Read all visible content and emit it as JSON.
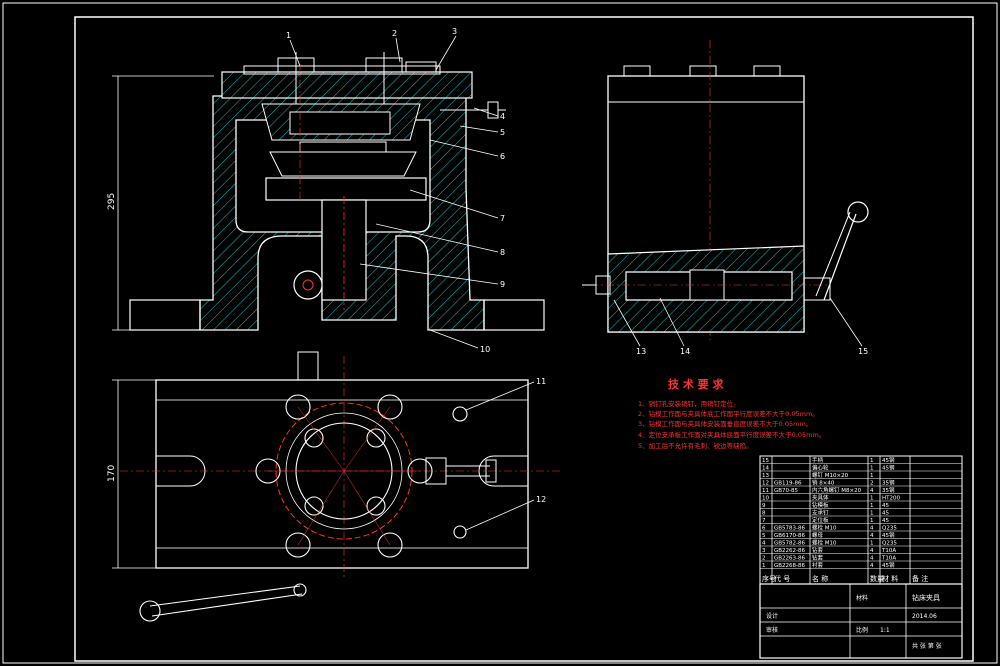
{
  "drawing": {
    "background_color": "#000000",
    "line_color": "#ffffff",
    "hatch_color": "#00c8c8",
    "centerline_color": "#ff3030",
    "tech_color": "#ff3030"
  },
  "balloons": [
    "1",
    "2",
    "3",
    "4",
    "5",
    "6",
    "7",
    "8",
    "9",
    "10",
    "11",
    "12",
    "13",
    "14",
    "15"
  ],
  "dims": {
    "height_front": "295",
    "height_plan": "170"
  },
  "tech_requirements": {
    "title": "技 术 要 求",
    "items": [
      "1、销钉孔安装销钉，用销钉定位。",
      "2、钻模工作面与夹具体底工作面平行度误差不大于0.05mm。",
      "3、钻模工作面与夹具体安装面垂直度误差不大于0.05mm。",
      "4、定位支承板工作面对夹具体底面平行度误差不大于0.05mm。",
      "5、加工后不允许有毛刺、锐边等缺陷。"
    ]
  },
  "parts_table": {
    "header": [
      "序号",
      "代  号",
      "名  称",
      "数量",
      "材  料",
      "备  注"
    ],
    "rows": [
      [
        "15",
        "",
        "手柄",
        "1",
        "45钢",
        ""
      ],
      [
        "14",
        "",
        "偏心轮",
        "1",
        "45钢",
        ""
      ],
      [
        "13",
        "",
        "螺钉 M10×20",
        "1",
        "",
        ""
      ],
      [
        "12",
        "GB119-86",
        "销 8×40",
        "2",
        "35钢",
        ""
      ],
      [
        "11",
        "GB70-85",
        "内六角螺钉 M8×20",
        "4",
        "35钢",
        ""
      ],
      [
        "10",
        "",
        "夹具体",
        "1",
        "HT200",
        ""
      ],
      [
        "9",
        "",
        "钻模板",
        "1",
        "45",
        ""
      ],
      [
        "8",
        "",
        "支承钉",
        "1",
        "45",
        ""
      ],
      [
        "7",
        "",
        "定位板",
        "1",
        "45",
        ""
      ],
      [
        "6",
        "GB5783-86",
        "螺栓 M10",
        "4",
        "Q235",
        ""
      ],
      [
        "5",
        "GB6170-86",
        "螺母",
        "4",
        "45钢",
        ""
      ],
      [
        "4",
        "GB5782-86",
        "螺栓 M10",
        "1",
        "Q235",
        ""
      ],
      [
        "3",
        "GB2262-86",
        "钻套",
        "4",
        "T10A",
        ""
      ],
      [
        "2",
        "GB2263-86",
        "钻套",
        "4",
        "T10A",
        ""
      ],
      [
        "1",
        "GB2268-86",
        "衬套",
        "4",
        "45钢",
        ""
      ]
    ]
  },
  "title_block": {
    "drawing_name": "钻床夹具",
    "material_label": "材料",
    "scale_label": "比例",
    "scale": "1:1",
    "sheet": "共 张 第 张",
    "designer_label": "设计",
    "checker_label": "审核",
    "date": "2014.06"
  }
}
